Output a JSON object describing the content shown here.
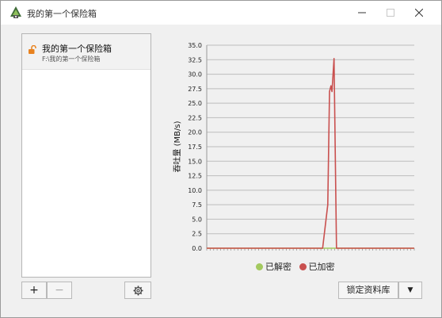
{
  "window": {
    "title": "我的第一个保险箱",
    "app_icon": "cryptomator-icon",
    "controls": [
      "minimize-icon",
      "maximize-icon",
      "close-icon"
    ]
  },
  "vaults": [
    {
      "name": "我的第一个保险箱",
      "path": "F:\\我的第一个保险箱",
      "status_icon": "unlocked-padlock-icon",
      "status_color": "#e8821f"
    }
  ],
  "list_toolbar": {
    "add_label": "+",
    "remove_label": "−",
    "settings_icon": "gear-icon"
  },
  "actions": {
    "lock_label": "锁定资料库",
    "dropdown_label": "▼"
  },
  "chart_data": {
    "type": "line",
    "ylabel": "吞吐量 (MB/s)",
    "xlabel": "",
    "ylim": [
      0,
      35
    ],
    "yticks": [
      "0.0",
      "2.5",
      "5.0",
      "7.5",
      "10.0",
      "12.5",
      "15.0",
      "17.5",
      "20.0",
      "22.5",
      "25.0",
      "27.5",
      "30.0",
      "32.5",
      "35.0"
    ],
    "x_count": 60,
    "grid": true,
    "legend_position": "bottom",
    "series": [
      {
        "name": "已解密",
        "color": "#a3c95f",
        "points": [
          [
            0,
            0
          ],
          [
            60,
            0
          ]
        ]
      },
      {
        "name": "已加密",
        "color": "#c9504f",
        "points": [
          [
            0,
            0
          ],
          [
            33.5,
            0
          ],
          [
            35,
            7.5
          ],
          [
            35.5,
            27
          ],
          [
            35.9,
            28
          ],
          [
            36.2,
            27
          ],
          [
            36.8,
            32.7
          ],
          [
            37.5,
            0
          ],
          [
            60,
            0
          ]
        ]
      }
    ]
  }
}
